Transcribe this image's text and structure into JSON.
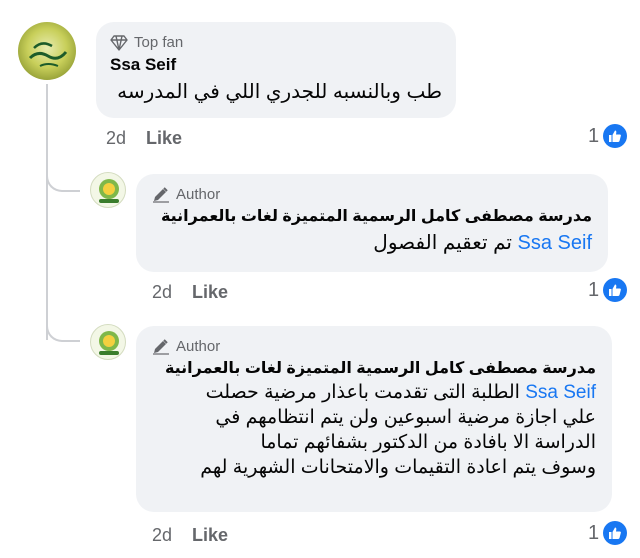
{
  "comments": [
    {
      "badge_icon": "diamond-icon",
      "badge": "Top fan",
      "author": "Ssa Seif",
      "text": "طب وبالنسبه للجدري اللي في المدرسه",
      "time": "2d",
      "like_label": "Like",
      "reaction_count": "1"
    },
    {
      "badge_icon": "pencil-icon",
      "badge": "Author",
      "author": "مدرسة مصطفى كامل الرسمية المتميزة لغات بالعمرانية",
      "mention": "Ssa Seif",
      "text": "تم تعقيم الفصول",
      "time": "2d",
      "like_label": "Like",
      "reaction_count": "1"
    },
    {
      "badge_icon": "pencil-icon",
      "badge": "Author",
      "author": "مدرسة مصطفى كامل الرسمية المتميزة لغات بالعمرانية",
      "mention": "Ssa Seif",
      "text_lines": [
        "الطلبة التى تقدمت باعذار مرضية حصلت",
        "علي اجازة مرضية اسبوعين ولن يتم انتظامهم في",
        "الدراسة الا بافادة من الدكتور بشفائهم تماما",
        "وسوف يتم اعادة التقيمات والامتحانات الشهرية لهم"
      ],
      "time": "2d",
      "like_label": "Like",
      "reaction_count": "1"
    }
  ],
  "colors": {
    "bubble": "#f0f2f5",
    "mention": "#1877f2",
    "like_icon": "#1877f2",
    "meta_text": "#65676b"
  }
}
